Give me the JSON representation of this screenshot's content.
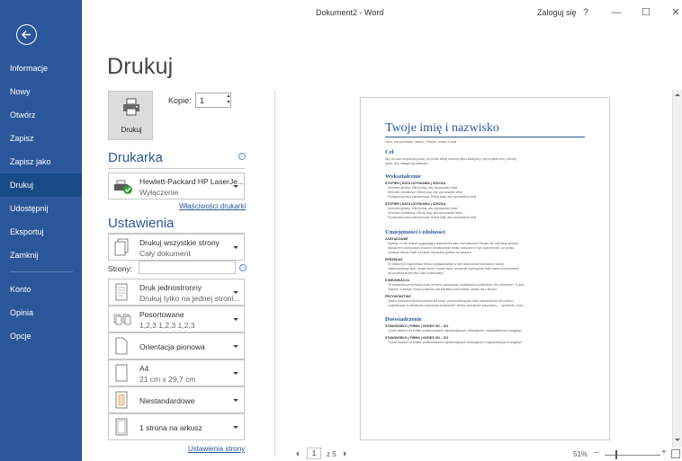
{
  "app": {
    "doc_title": "Dokument2 - Word",
    "login": "Zaloguj się",
    "help": "?",
    "minimize": "—",
    "maximize": "☐",
    "close": "✕"
  },
  "nav": {
    "items": [
      "Informacje",
      "Nowy",
      "Otwórz",
      "Zapisz",
      "Zapisz jako",
      "Drukuj",
      "Udostępnij",
      "Eksportuj",
      "Zamknij",
      "Konto",
      "Opinia",
      "Opcje"
    ],
    "active": "Drukuj"
  },
  "print": {
    "title": "Drukuj",
    "button_label": "Drukuj",
    "copies_label": "Kopie:",
    "copies_value": "1"
  },
  "printer": {
    "section_title": "Drukarka",
    "name": "Hewlett-Packard HP LaserJe...",
    "status": "Wyłączenie",
    "properties_link": "Właściwości drukarki"
  },
  "settings": {
    "section_title": "Ustawienia",
    "pages_label": "Strony:",
    "pages_value": "",
    "options": [
      {
        "line1": "Drukuj wszystkie strony",
        "line2": "Cały dokument"
      },
      {
        "line1": "Druk jednostronny",
        "line2": "Drukuj tylko na jednej stroni..."
      },
      {
        "line1": "Posortowane",
        "line2": "1,2,3   1,2,3   1,2,3"
      },
      {
        "line1": "Orientacja pionowa",
        "line2": ""
      },
      {
        "line1": "A4",
        "line2": "21 cm x 29,7 cm"
      },
      {
        "line1": "Niestandardowe",
        "line2": ""
      },
      {
        "line1": "1 strona na arkusz",
        "line2": ""
      }
    ],
    "page_setup_link": "Ustawienia strony"
  },
  "preview": {
    "name": "Twoje imię i nazwisko",
    "contact": "Ulica, kod pocztowy, miasto | Telefon | Adres e-mail",
    "sections": [
      {
        "heading": "Cel",
        "lines": [
          "Aby od razu rozpocząć pracę, po prostu kliknij dowolny tekst zastępczy (na przykład ten) i zacznij",
          "pisać, aby zastąpić go własnym."
        ]
      },
      {
        "heading": "Wykształcenie",
        "lines": [
          "STOPIEŃ | DATA UZYSKANIA | SZKOŁA",
          "Kierunek główny: Kliknij tutaj, aby wprowadzić tekst",
          "Kierunek dodatkowy: Kliknij tutaj, aby wprowadzić tekst",
          "Powiązana praca zaliczeniowa: Kliknij tutaj, aby wprowadzić tekst",
          "STOPIEŃ | DATA UZYSKANIA | SZKOŁA",
          "Kierunek główny: Kliknij tutaj, aby wprowadzić tekst",
          "Kierunek dodatkowy: Kliknij tutaj, aby wprowadzić tekst",
          "Powiązana praca zaliczeniowa: Kliknij tutaj, aby wprowadzić tekst"
        ]
      },
      {
        "heading": "Umiejętności i zdolności",
        "lines": [
          "ZARZĄDZANIE",
          "Myślisz, że tak dobrze wyglądający dokument trudno sformatować? Wcale nie! Aby łatwo jednym",
          "kliknięciem zastosować dowolne formatowanie tekstu widoczne w tym dokumencie, po prostu",
          "sprawdź obszar Style na karcie Narzędzia główne na wstążce.",
          "SPRZEDAŻ",
          "W niektórych fragmentach tekstu przykładowego w tym dokumencie wskazano nazwę",
          "zastosowanego stylu, dzięki czemu można łatwo ponownie zastosować takie samo formatowanie.",
          "Na przykład ta jest styl Lista punktowana.",
          "KOMUNIKACJA",
          "To wspaniała prezentacja może na serio wzbudzanie zadziwienia czytelników. Nie uwierzysz? To jest",
          "miejsce, w którym można pokazać, jak potrafisz przemawiać i bawić się z innymi.",
          "PRZYWÓDZTWO",
          "Jesteś prezesem stowarzyszenia lub klubu, przewodniczącym rady mieszkańców lub umiesz",
          "zaopiekować w określonej organizacji społecznej? Jesteś naturalnym przywódcą — opowiedz o tym!"
        ]
      },
      {
        "heading": "Doświadczenie",
        "lines": [
          "STANOWISKO | FIRMA | OKRES OD – DO",
          "To jest miejsce na krótkie podsumowanie najważniejszych obowiązków i najważniejszych osiągnięć.",
          "STANOWISKO | FIRMA | OKRES OD – DO",
          "To jest miejsce na krótkie podsumowanie najważniejszych obowiązków i najważniejszych osiągnięć."
        ]
      }
    ]
  },
  "footer": {
    "page_current": "1",
    "page_of": "z 5",
    "zoom": "51%",
    "zoom_minus": "–",
    "zoom_plus": "+",
    "zoom_level": 0.2
  },
  "colors": {
    "accent": "#2b579a",
    "sidebar": "#2b579a",
    "sidebar_active": "#184a87"
  }
}
